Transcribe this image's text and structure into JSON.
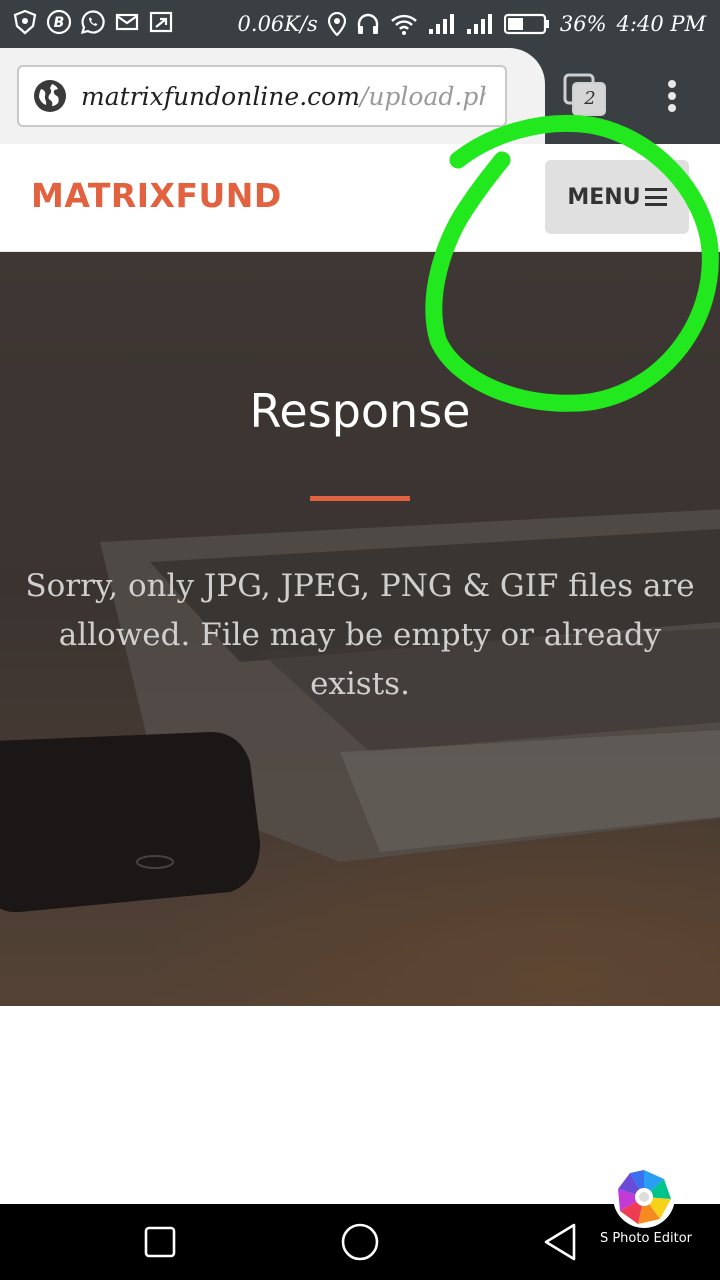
{
  "status_bar": {
    "speed": "0.06K/s",
    "battery": "36%",
    "time": "4:40 PM",
    "icons": [
      "shield-icon",
      "b-badge-icon",
      "whatsapp-icon",
      "mail-icon",
      "cast-icon",
      "location-icon",
      "headset-icon",
      "wifi-icon",
      "signal-icon",
      "signal-icon",
      "battery-icon"
    ]
  },
  "browser": {
    "url_host": "matrixfundonline.com",
    "url_path": "/upload.php",
    "tab_count": "2"
  },
  "site": {
    "brand": "MATRIXFUND",
    "menu_label": "MENU",
    "accent_color": "#e2613f"
  },
  "hero": {
    "title": "Response",
    "message": "Sorry, only JPG, JPEG, PNG & GIF files are allowed.   File may be empty or already exists."
  },
  "overlay": {
    "photo_editor_label": "S Photo Editor",
    "annotation_color": "#22e81e"
  },
  "nav": {
    "buttons": [
      "recents-icon",
      "home-icon",
      "back-icon"
    ]
  }
}
